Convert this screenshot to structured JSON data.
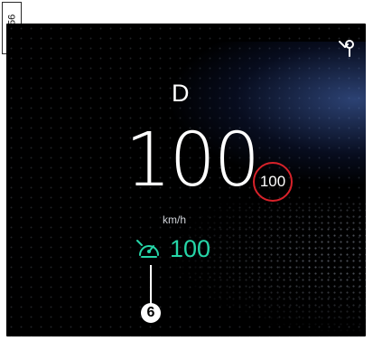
{
  "figure": {
    "id": "61856"
  },
  "display": {
    "gear": "D",
    "speed": "100",
    "unit": "km/h",
    "speed_limit": "100",
    "limiter_value": "100",
    "callout_number": "6",
    "icons": [
      "wrench-icon",
      "speed-limiter-icon"
    ],
    "colors": {
      "background": "#000000",
      "text": "#ffffff",
      "limit_ring": "#d8222a",
      "limiter": "#26d6a8"
    }
  }
}
